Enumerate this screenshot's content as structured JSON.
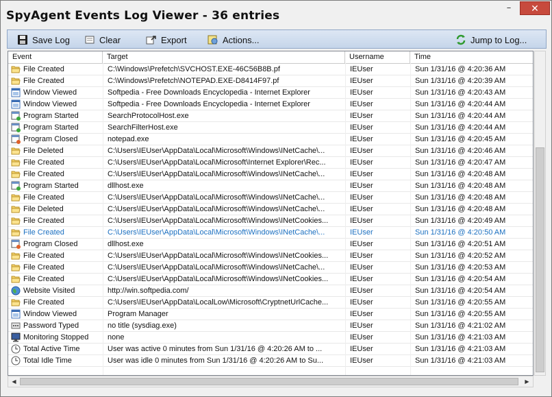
{
  "window": {
    "title": "SpyAgent Events Log Viewer - 36 entries",
    "minimize_glyph": "–",
    "close_glyph": "✕"
  },
  "toolbar": {
    "save_label": "Save Log",
    "clear_label": "Clear",
    "export_label": "Export",
    "actions_label": "Actions...",
    "jump_label": "Jump to Log..."
  },
  "columns": {
    "event": "Event",
    "target": "Target",
    "username": "Username",
    "time": "Time"
  },
  "rows": [
    {
      "event": "File Created",
      "icon": "folder-icon",
      "target": "C:\\Windows\\Prefetch\\SVCHOST.EXE-46C56B8B.pf",
      "user": "IEUser",
      "time": "Sun  1/31/16 @ 4:20:36 AM"
    },
    {
      "event": "File Created",
      "icon": "folder-icon",
      "target": "C:\\Windows\\Prefetch\\NOTEPAD.EXE-D8414F97.pf",
      "user": "IEUser",
      "time": "Sun  1/31/16 @ 4:20:39 AM"
    },
    {
      "event": "Window Viewed",
      "icon": "window-icon",
      "target": "Softpedia - Free Downloads Encyclopedia - Internet Explorer",
      "user": "IEUser",
      "time": "Sun  1/31/16 @ 4:20:43 AM"
    },
    {
      "event": "Window Viewed",
      "icon": "window-icon",
      "target": "Softpedia - Free Downloads Encyclopedia - Internet Explorer",
      "user": "IEUser",
      "time": "Sun  1/31/16 @ 4:20:44 AM"
    },
    {
      "event": "Program Started",
      "icon": "program-started-icon",
      "target": "SearchProtocolHost.exe",
      "user": "IEUser",
      "time": "Sun  1/31/16 @ 4:20:44 AM"
    },
    {
      "event": "Program Started",
      "icon": "program-started-icon",
      "target": "SearchFilterHost.exe",
      "user": "IEUser",
      "time": "Sun  1/31/16 @ 4:20:44 AM"
    },
    {
      "event": "Program Closed",
      "icon": "program-closed-icon",
      "target": "notepad.exe",
      "user": "IEUser",
      "time": "Sun  1/31/16 @ 4:20:45 AM"
    },
    {
      "event": "File Deleted",
      "icon": "folder-icon",
      "target": "C:\\Users\\IEUser\\AppData\\Local\\Microsoft\\Windows\\INetCache\\...",
      "user": "IEUser",
      "time": "Sun  1/31/16 @ 4:20:46 AM"
    },
    {
      "event": "File Created",
      "icon": "folder-icon",
      "target": "C:\\Users\\IEUser\\AppData\\Local\\Microsoft\\Internet Explorer\\Rec...",
      "user": "IEUser",
      "time": "Sun  1/31/16 @ 4:20:47 AM"
    },
    {
      "event": "File Created",
      "icon": "folder-icon",
      "target": "C:\\Users\\IEUser\\AppData\\Local\\Microsoft\\Windows\\INetCache\\...",
      "user": "IEUser",
      "time": "Sun  1/31/16 @ 4:20:48 AM"
    },
    {
      "event": "Program Started",
      "icon": "program-started-icon",
      "target": "dllhost.exe",
      "user": "IEUser",
      "time": "Sun  1/31/16 @ 4:20:48 AM"
    },
    {
      "event": "File Created",
      "icon": "folder-icon",
      "target": "C:\\Users\\IEUser\\AppData\\Local\\Microsoft\\Windows\\INetCache\\...",
      "user": "IEUser",
      "time": "Sun  1/31/16 @ 4:20:48 AM"
    },
    {
      "event": "File Deleted",
      "icon": "folder-icon",
      "target": "C:\\Users\\IEUser\\AppData\\Local\\Microsoft\\Windows\\INetCache\\...",
      "user": "IEUser",
      "time": "Sun  1/31/16 @ 4:20:48 AM"
    },
    {
      "event": "File Created",
      "icon": "folder-icon",
      "target": "C:\\Users\\IEUser\\AppData\\Local\\Microsoft\\Windows\\INetCookies...",
      "user": "IEUser",
      "time": "Sun  1/31/16 @ 4:20:49 AM"
    },
    {
      "event": "File Created",
      "icon": "folder-icon",
      "target": "C:\\Users\\IEUser\\AppData\\Local\\Microsoft\\Windows\\INetCache\\...",
      "user": "IEUser",
      "time": "Sun  1/31/16 @ 4:20:50 AM",
      "selected": true
    },
    {
      "event": "Program Closed",
      "icon": "program-closed-icon",
      "target": "dllhost.exe",
      "user": "IEUser",
      "time": "Sun  1/31/16 @ 4:20:51 AM"
    },
    {
      "event": "File Created",
      "icon": "folder-icon",
      "target": "C:\\Users\\IEUser\\AppData\\Local\\Microsoft\\Windows\\INetCookies...",
      "user": "IEUser",
      "time": "Sun  1/31/16 @ 4:20:52 AM"
    },
    {
      "event": "File Created",
      "icon": "folder-icon",
      "target": "C:\\Users\\IEUser\\AppData\\Local\\Microsoft\\Windows\\INetCache\\...",
      "user": "IEUser",
      "time": "Sun  1/31/16 @ 4:20:53 AM"
    },
    {
      "event": "File Created",
      "icon": "folder-icon",
      "target": "C:\\Users\\IEUser\\AppData\\Local\\Microsoft\\Windows\\INetCookies...",
      "user": "IEUser",
      "time": "Sun  1/31/16 @ 4:20:54 AM"
    },
    {
      "event": "Website Visited",
      "icon": "globe-icon",
      "target": "http://win.softpedia.com/",
      "user": "IEUser",
      "time": "Sun  1/31/16 @ 4:20:54 AM"
    },
    {
      "event": "File Created",
      "icon": "folder-icon",
      "target": "C:\\Users\\IEUser\\AppData\\LocalLow\\Microsoft\\CryptnetUrlCache...",
      "user": "IEUser",
      "time": "Sun  1/31/16 @ 4:20:55 AM"
    },
    {
      "event": "Window Viewed",
      "icon": "window-icon",
      "target": "Program Manager",
      "user": "IEUser",
      "time": "Sun  1/31/16 @ 4:20:55 AM"
    },
    {
      "event": "Password Typed",
      "icon": "password-icon",
      "target": "no title (sysdiag.exe)",
      "user": "IEUser",
      "time": "Sun  1/31/16 @ 4:21:02 AM"
    },
    {
      "event": "Monitoring Stopped",
      "icon": "monitor-icon",
      "target": "none",
      "user": "IEUser",
      "time": "Sun  1/31/16 @ 4:21:03 AM"
    },
    {
      "event": "Total Active Time",
      "icon": "clock-icon",
      "target": "User was active 0 minutes from Sun  1/31/16 @ 4:20:26 AM   to ...",
      "user": "IEUser",
      "time": "Sun  1/31/16 @ 4:21:03 AM"
    },
    {
      "event": "Total Idle Time",
      "icon": "clock-icon",
      "target": "User was idle 0 minutes from Sun  1/31/16 @ 4:20:26 AM   to Su...",
      "user": "IEUser",
      "time": "Sun  1/31/16 @ 4:21:03 AM"
    }
  ],
  "colors": {
    "selected_text": "#1a6fc0",
    "toolbar_top": "#dde7f4",
    "toolbar_bottom": "#c5d5ea",
    "close_button": "#c74a3d"
  }
}
